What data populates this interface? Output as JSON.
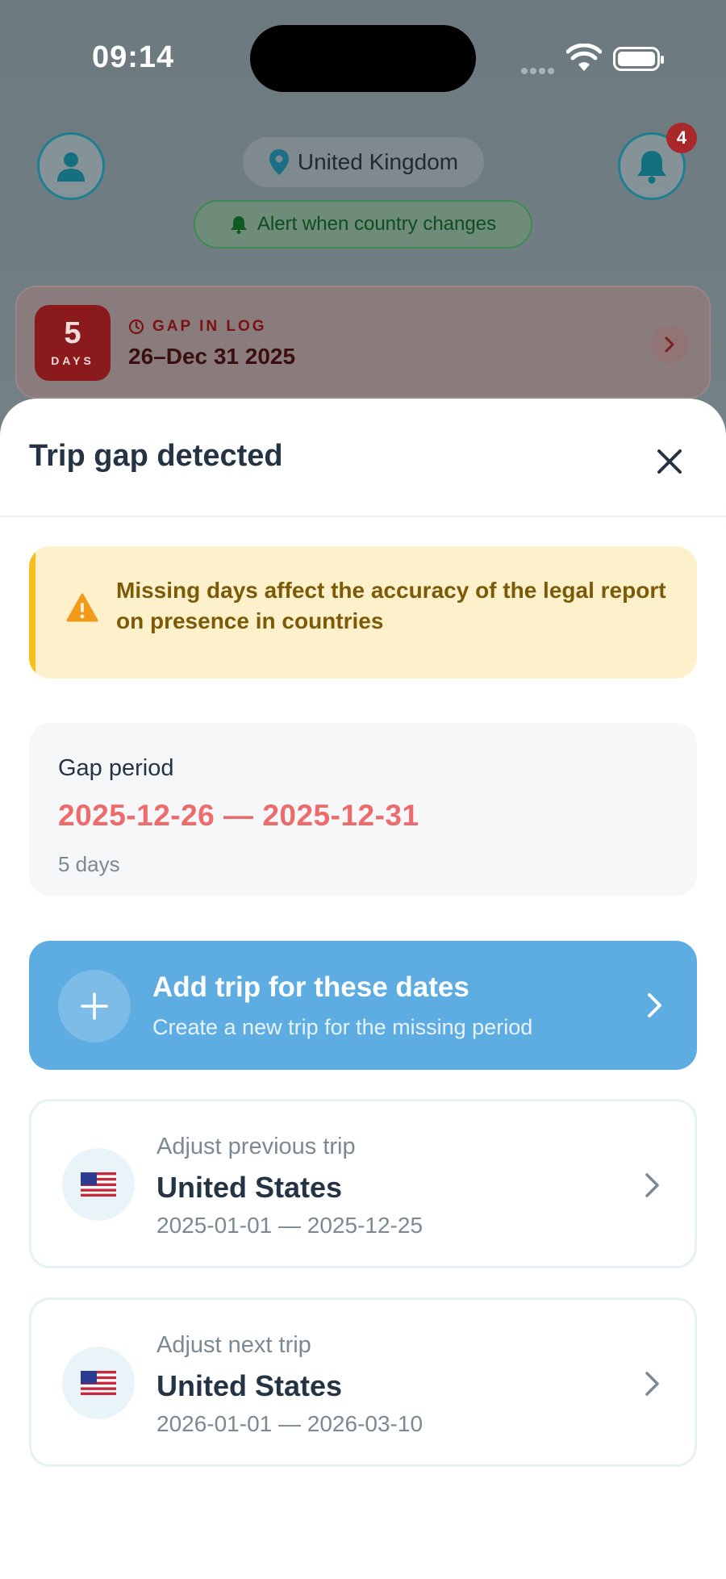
{
  "status_bar": {
    "time": "09:14"
  },
  "header": {
    "country": "United Kingdom",
    "alert_label": "Alert when country changes",
    "notification_count": "4"
  },
  "gap_card": {
    "days_number": "5",
    "days_label": "DAYS",
    "kicker": "GAP IN LOG",
    "dates": "26–Dec 31 2025"
  },
  "sheet": {
    "title": "Trip gap detected",
    "warning": "Missing days affect the accuracy of the legal report on presence in countries",
    "period": {
      "label": "Gap period",
      "range": "2025-12-26 — 2025-12-31",
      "days": "5 days"
    },
    "add_trip": {
      "title": "Add trip for these dates",
      "subtitle": "Create a new trip for the missing period"
    },
    "previous_trip": {
      "kicker": "Adjust previous trip",
      "country": "United States",
      "dates": "2025-01-01 — 2025-12-25"
    },
    "next_trip": {
      "kicker": "Adjust next trip",
      "country": "United States",
      "dates": "2026-01-01 — 2026-03-10"
    }
  },
  "colors": {
    "accent_blue": "#5dace2",
    "danger_red": "#ee6b6b",
    "warning_bg": "#fdf1cc",
    "warning_bar": "#f7bf1c",
    "teal": "#1f7f91"
  },
  "icons": {
    "avatar": "person-icon",
    "bell": "bell-icon",
    "pin": "location-pin-icon",
    "close": "close-icon",
    "warning": "warning-triangle-icon",
    "add": "plus-icon",
    "chevron": "chevron-right-icon",
    "flag": "us-flag-icon",
    "clock": "clock-icon"
  }
}
